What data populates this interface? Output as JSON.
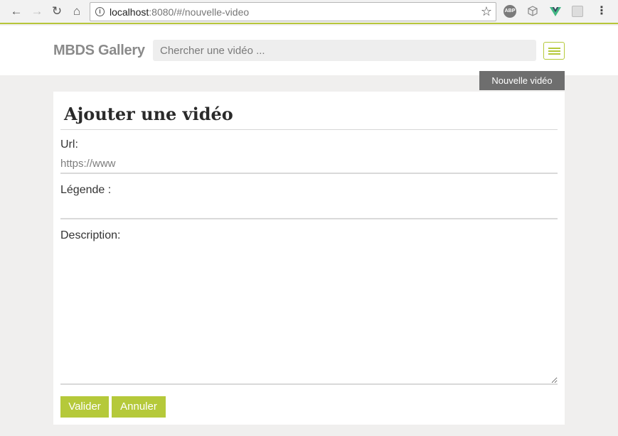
{
  "browser": {
    "url_host": "localhost",
    "url_rest": ":8080/#/nouvelle-video",
    "extensions": [
      "ABP",
      "cube",
      "vue",
      "grid"
    ]
  },
  "header": {
    "brand": "MBDS Gallery",
    "search_placeholder": "Chercher une vidéo ...",
    "menu_icon": "hamburger-icon"
  },
  "new_video_tab": "Nouvelle vidéo",
  "form": {
    "title": "Ajouter une vidéo",
    "url_label": "Url:",
    "url_placeholder": "https://www",
    "legend_label": "Légende :",
    "description_label": "Description:",
    "submit_label": "Valider",
    "cancel_label": "Annuler"
  },
  "colors": {
    "accent": "#b5c93a",
    "tab_bg": "#6e6e6e",
    "page_bg": "#f0efee"
  }
}
